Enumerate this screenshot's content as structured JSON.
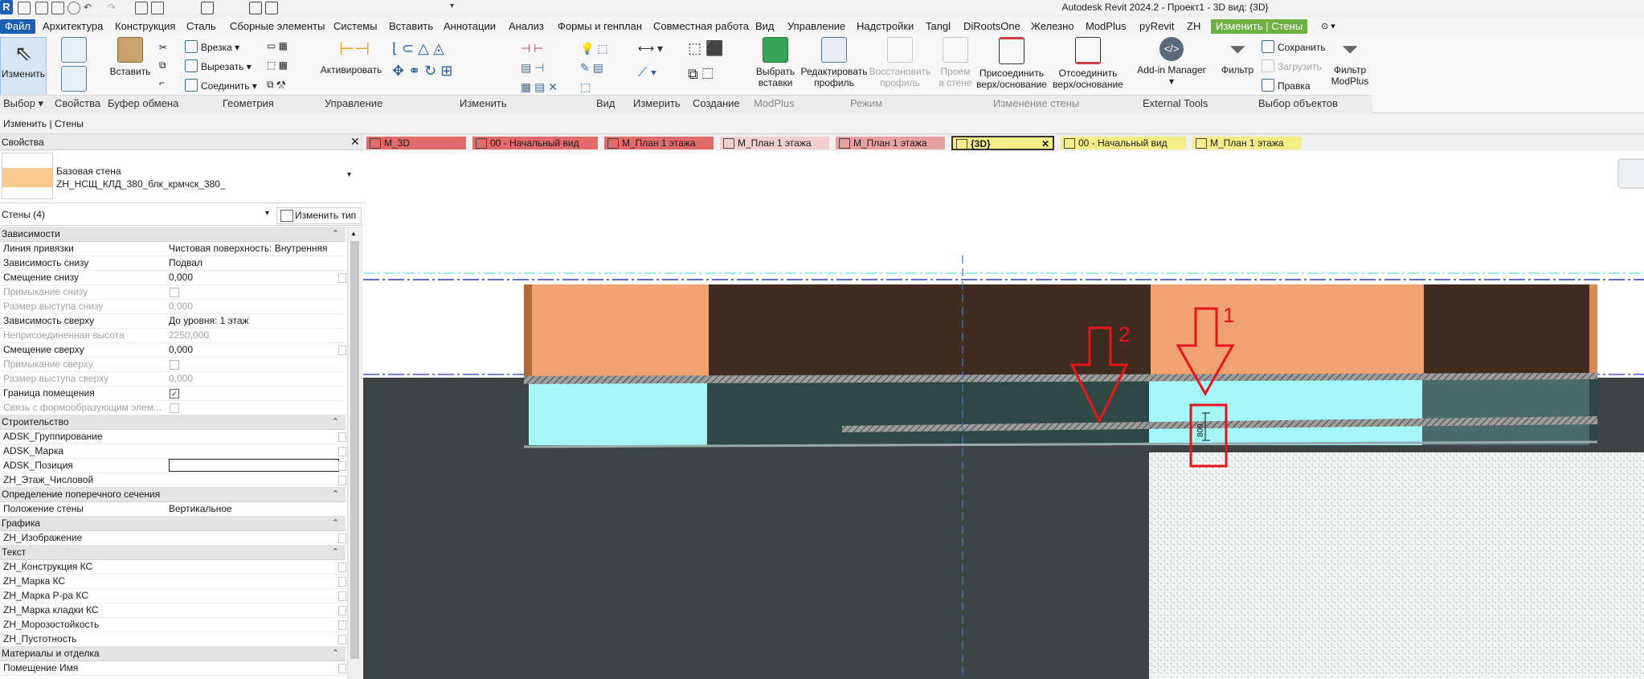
{
  "app": {
    "title": "Autodesk Revit 2024.2 - Проект1 - 3D вид: {3D}",
    "logo_letter": "R"
  },
  "menu": {
    "file": "Файл",
    "tabs": [
      "Архитектура",
      "Конструкция",
      "Сталь",
      "Сборные элементы",
      "Системы",
      "Вставить",
      "Аннотации",
      "Анализ",
      "Формы и генплан",
      "Совместная работа",
      "Вид",
      "Управление",
      "Надстройки",
      "Tangl",
      "DiRootsOne",
      "Железно",
      "ModPlus",
      "pyRevit",
      "ZH"
    ],
    "context_tab": "Изменить | Стены"
  },
  "ribbon": {
    "modify": "Изменить",
    "paste": "Вставить",
    "cut_profile": "Врезка",
    "cut": "Вырезать",
    "join": "Соединить",
    "activate": "Активировать",
    "select_inserts": [
      "Выбрать",
      "вставки"
    ],
    "edit_profile": [
      "Редактировать",
      "профиль"
    ],
    "reset_profile": [
      "Восстановить",
      "профиль"
    ],
    "wall_opening": [
      "Проем",
      "в стене"
    ],
    "attach": [
      "Присоединить",
      "верх/основание"
    ],
    "detach": [
      "Отсоединить",
      "верх/основание"
    ],
    "addin_manager": "Add-in Manager",
    "filter": "Фильтр",
    "save": "Сохранить",
    "load": "Загрузить",
    "edit": "Правка",
    "filter_modplus": [
      "Фильтр",
      "ModPlus"
    ],
    "panels": [
      {
        "label": "Выбор ▾",
        "enabled": true
      },
      {
        "label": "Свойства",
        "enabled": true
      },
      {
        "label": "Буфер обмена",
        "enabled": true
      },
      {
        "label": "Геометрия",
        "enabled": true
      },
      {
        "label": "Управление",
        "enabled": true
      },
      {
        "label": "Изменить",
        "enabled": true
      },
      {
        "label": "Вид",
        "enabled": true
      },
      {
        "label": "Измерить",
        "enabled": true
      },
      {
        "label": "Создание",
        "enabled": true
      },
      {
        "label": "ModPlus",
        "enabled": false
      },
      {
        "label": "Режим",
        "enabled": false
      },
      {
        "label": "Изменение стены",
        "enabled": false
      },
      {
        "label": "External Tools",
        "enabled": true
      },
      {
        "label": "Выбор объектов",
        "enabled": true
      }
    ]
  },
  "options_bar": {
    "context": "Изменить | Стены"
  },
  "properties": {
    "title": "Свойства",
    "type_name_line1": "Базовая стена",
    "type_name_line2": "ZH_НСЩ_КЛД_380_блк_крмчск_380_",
    "instance_filter": "Стены (4)",
    "edit_type": "Изменить тип",
    "sections": [
      {
        "name": "Зависимости",
        "rows": [
          {
            "name": "Линия привязки",
            "value": "Чистовая поверхность: Внутренняя",
            "dim": false
          },
          {
            "name": "Зависимость снизу",
            "value": "Подвал",
            "dim": false
          },
          {
            "name": "Смещение снизу",
            "value": "0,000",
            "dim": false
          },
          {
            "name": "Примыкание снизу",
            "value": "",
            "dim": true,
            "check": "off"
          },
          {
            "name": "Размер выступа снизу",
            "value": "0,000",
            "dim": true
          },
          {
            "name": "Зависимость сверху",
            "value": "До уровня: 1 этаж",
            "dim": false
          },
          {
            "name": "Неприсоединенная высота",
            "value": "2250,000",
            "dim": true
          },
          {
            "name": "Смещение сверху",
            "value": "0,000",
            "dim": false
          },
          {
            "name": "Примыкание сверху",
            "value": "",
            "dim": true,
            "check": "off"
          },
          {
            "name": "Размер выступа сверху",
            "value": "0,000",
            "dim": true
          },
          {
            "name": "Граница помещения",
            "value": "",
            "dim": false,
            "check": "on"
          },
          {
            "name": "Связь с формообразующим элем...",
            "value": "",
            "dim": true,
            "check": "off"
          }
        ]
      },
      {
        "name": "Строительство",
        "rows": [
          {
            "name": "ADSK_Группирование",
            "value": "",
            "dim": false
          },
          {
            "name": "ADSK_Марка",
            "value": "",
            "dim": false
          },
          {
            "name": "ADSK_Позиция",
            "value": "",
            "dim": false,
            "boxed": true
          },
          {
            "name": "ZH_Этаж_Числовой",
            "value": "",
            "dim": false
          }
        ]
      },
      {
        "name": "Определение поперечного сечения",
        "rows": [
          {
            "name": "Положение стены",
            "value": "Вертикальное",
            "dim": false
          }
        ]
      },
      {
        "name": "Графика",
        "rows": [
          {
            "name": "ZH_Изображение",
            "value": "",
            "dim": false
          }
        ]
      },
      {
        "name": "Текст",
        "rows": [
          {
            "name": "ZH_Конструкция КС",
            "value": "",
            "dim": false
          },
          {
            "name": "ZH_Марка КС",
            "value": "",
            "dim": false
          },
          {
            "name": "ZH_Марка Р-ра КС",
            "value": "",
            "dim": false
          },
          {
            "name": "ZH_Марка кладки КС",
            "value": "",
            "dim": false
          },
          {
            "name": "ZH_Морозостойкость",
            "value": "",
            "dim": false
          },
          {
            "name": "ZH_Пустотность",
            "value": "",
            "dim": false
          }
        ]
      },
      {
        "name": "Материалы и отделка",
        "rows": [
          {
            "name": "Помещение Имя",
            "value": "",
            "dim": false
          }
        ]
      }
    ]
  },
  "view_tabs": [
    {
      "label": "М_3D",
      "color": "#e26a6a",
      "active": false
    },
    {
      "label": "00 - Начальный вид",
      "color": "#e26a6a",
      "active": false
    },
    {
      "label": "М_План 1 этажа",
      "color": "#e26a6a",
      "active": false
    },
    {
      "label": "М_План 1 этажа",
      "color": "#f2d0d0",
      "active": false
    },
    {
      "label": "М_План 1 этажа",
      "color": "#e9a0a0",
      "active": false
    },
    {
      "label": "{3D}",
      "color": "#f3ee88",
      "active": true
    },
    {
      "label": "00 - Начальный вид",
      "color": "#f3ee88",
      "active": false
    },
    {
      "label": "М_План 1 этажа",
      "color": "#f3ee88",
      "active": false
    }
  ],
  "annotations": {
    "arrow_1_label": "1",
    "arrow_2_label": "2",
    "dimension_text": "800"
  },
  "colors": {
    "brick": "#f0a270",
    "wall_dark": "#412c22",
    "aqua": "#a5f7f7",
    "dark_teal": "#2e4846",
    "ground": "#3e4344",
    "red_annotation": "#e8141a",
    "context_green": "#6fb043",
    "file_blue": "#1a5fb4"
  }
}
